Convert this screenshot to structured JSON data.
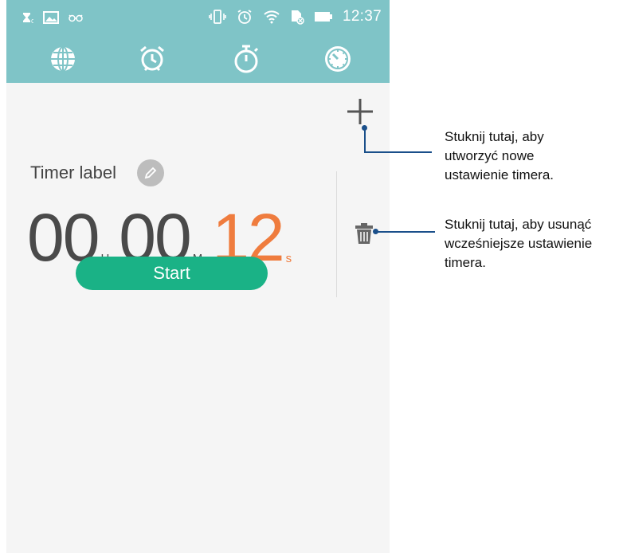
{
  "status_bar": {
    "time": "12:37",
    "left_icons": [
      "hourglass-notification-icon",
      "image-notification-icon",
      "glasses-notification-icon"
    ],
    "right_icons": [
      "vibrate-icon",
      "alarm-status-icon",
      "wifi-icon",
      "sim-card-icon",
      "battery-icon"
    ]
  },
  "tabs": [
    {
      "icon": "globe-icon",
      "name": "world-clock"
    },
    {
      "icon": "alarm-clock-icon",
      "name": "alarm"
    },
    {
      "icon": "stopwatch-icon",
      "name": "stopwatch"
    },
    {
      "icon": "timer-icon",
      "name": "timer",
      "active": true
    }
  ],
  "timer": {
    "label": "Timer label",
    "hours": "00",
    "hours_unit": "H",
    "minutes": "00",
    "minutes_unit": "M",
    "seconds": "12",
    "seconds_unit": "s",
    "start_label": "Start"
  },
  "callouts": {
    "add": "Stuknij tutaj, aby utworzyć nowe ustawienie timera.",
    "delete": "Stuknij tutaj, aby usunąć wcześniejsze ustawienie timera."
  },
  "colors": {
    "header": "#7fc4c7",
    "accent_orange": "#ef7c3e",
    "start_green": "#1ab286",
    "callout_line": "#1a4f8a"
  }
}
